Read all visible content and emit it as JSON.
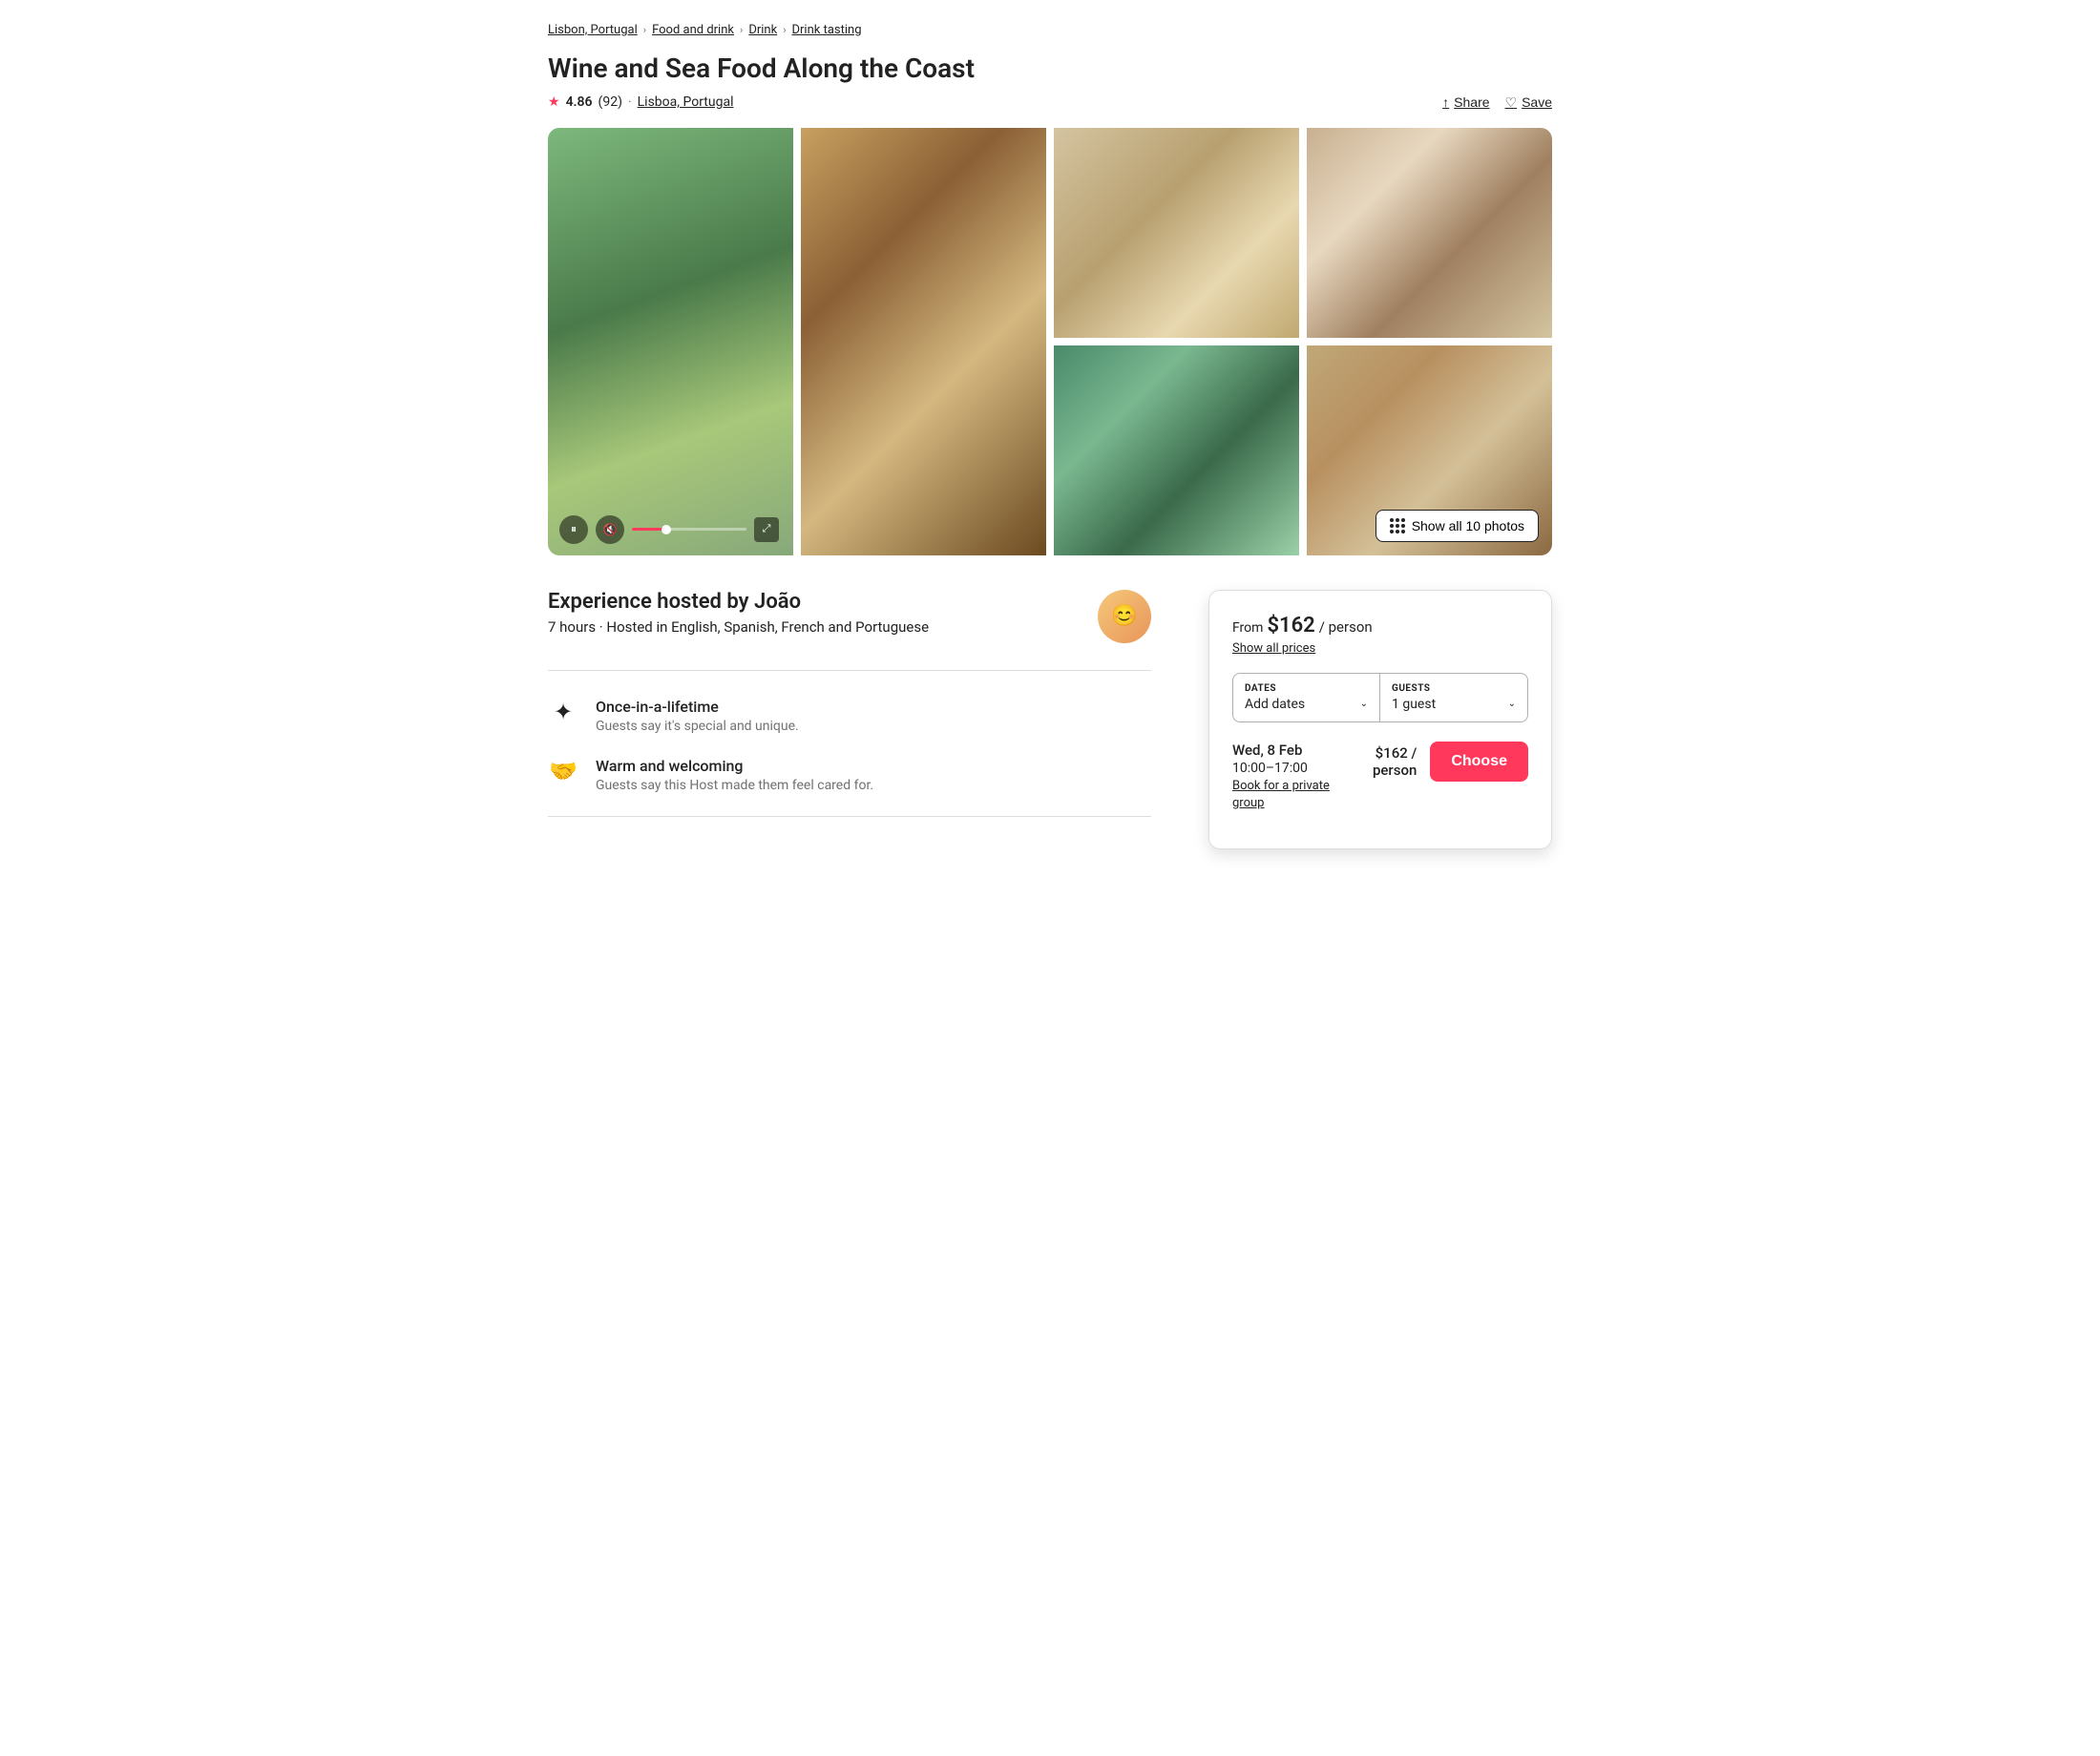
{
  "breadcrumb": {
    "items": [
      {
        "label": "Lisbon, Portugal",
        "href": "#"
      },
      {
        "label": "Food and drink",
        "href": "#"
      },
      {
        "label": "Drink",
        "href": "#"
      },
      {
        "label": "Drink tasting",
        "href": "#"
      }
    ]
  },
  "listing": {
    "title": "Wine and Sea Food Along the Coast",
    "rating": {
      "value": "4.86",
      "count": "(92)",
      "location": "Lisboa, Portugal"
    },
    "actions": {
      "share": "Share",
      "save": "Save"
    }
  },
  "photos": {
    "show_all_label": "Show all 10 photos",
    "photo_count": 10
  },
  "host": {
    "title": "Experience hosted by João",
    "meta": "7 hours · Hosted in English, Spanish, French and Portuguese",
    "avatar_emoji": "😊"
  },
  "features": [
    {
      "icon": "✦",
      "title": "Once-in-a-lifetime",
      "description": "Guests say it's special and unique."
    },
    {
      "icon": "🤝",
      "title": "Warm and welcoming",
      "description": "Guests say this Host made them feel cared for."
    }
  ],
  "booking": {
    "from_label": "From",
    "price": "$162",
    "price_unit": "/ person",
    "show_prices_label": "Show all prices",
    "dates_label": "DATES",
    "dates_value": "Add dates",
    "guests_label": "GUESTS",
    "guests_value": "1 guest",
    "date_option": {
      "date": "Wed, 8 Feb",
      "time": "10:00–17:00",
      "book_private": "Book for a private group",
      "price": "$162 / person"
    },
    "choose_label": "Choose"
  },
  "icons": {
    "share_unicode": "↑",
    "heart_unicode": "♡",
    "pause_unicode": "⏸",
    "mute_unicode": "🔇",
    "expand_unicode": "⤢",
    "chevron_down": "⌄",
    "grid_label": "grid-icon"
  }
}
